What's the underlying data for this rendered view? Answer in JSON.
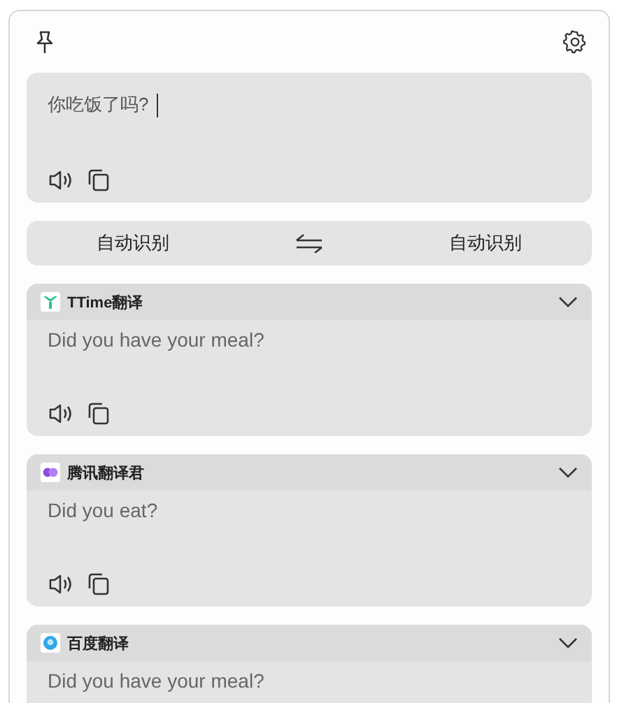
{
  "source": {
    "value": "你吃饭了吗?"
  },
  "languages": {
    "from": "自动识别",
    "to": "自动识别"
  },
  "results": [
    {
      "service": "TTime翻译",
      "kind": "ttime",
      "text": "Did you have your meal?"
    },
    {
      "service": "腾讯翻译君",
      "kind": "tencent",
      "text": "Did you eat?"
    },
    {
      "service": "百度翻译",
      "kind": "baidu",
      "text": "Did you have your meal?"
    }
  ]
}
